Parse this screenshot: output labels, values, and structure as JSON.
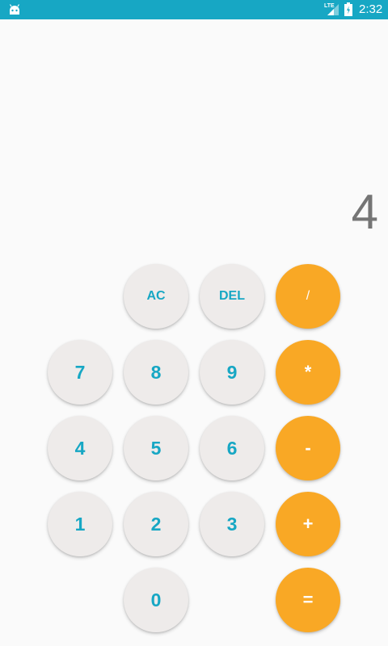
{
  "status_bar": {
    "network_label": "LTE",
    "time": "2:32",
    "color": "#17A7C4",
    "icons": [
      "android-icon",
      "signal-icon",
      "battery-icon"
    ]
  },
  "display": {
    "value": "4"
  },
  "keypad": {
    "clear": "AC",
    "delete": "DEL",
    "divide": "/",
    "multiply": "*",
    "subtract": "-",
    "add": "+",
    "equals": "=",
    "digits": {
      "zero": "0",
      "one": "1",
      "two": "2",
      "three": "3",
      "four": "4",
      "five": "5",
      "six": "6",
      "seven": "7",
      "eight": "8",
      "nine": "9"
    }
  },
  "colors": {
    "accent": "#17A7C4",
    "operator": "#F9A825",
    "key_background": "#EEEBEA",
    "display_text": "#757575",
    "background": "#FAFAFA"
  }
}
